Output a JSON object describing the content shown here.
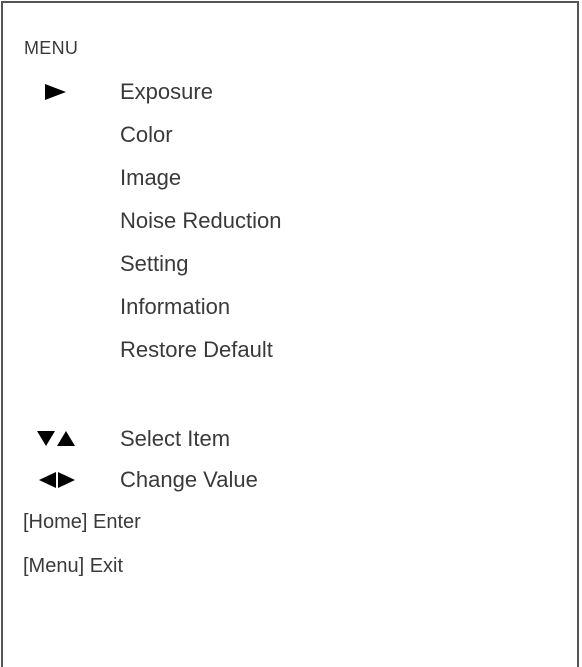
{
  "menu": {
    "title": "MENU",
    "selected_index": 0,
    "items": [
      {
        "label": "Exposure"
      },
      {
        "label": "Color"
      },
      {
        "label": "Image"
      },
      {
        "label": "Noise Reduction"
      },
      {
        "label": "Setting"
      },
      {
        "label": "Information"
      },
      {
        "label": "Restore Default"
      }
    ]
  },
  "hints": {
    "select": {
      "icon": "down-up-arrows-icon",
      "label": "Select Item"
    },
    "change": {
      "icon": "left-right-arrows-icon",
      "label": "Change Value"
    },
    "enter": "[Home] Enter",
    "exit": "[Menu] Exit"
  },
  "colors": {
    "text": "#3a3a3a",
    "icon": "#000000",
    "border": "#555555",
    "background": "#ffffff"
  }
}
